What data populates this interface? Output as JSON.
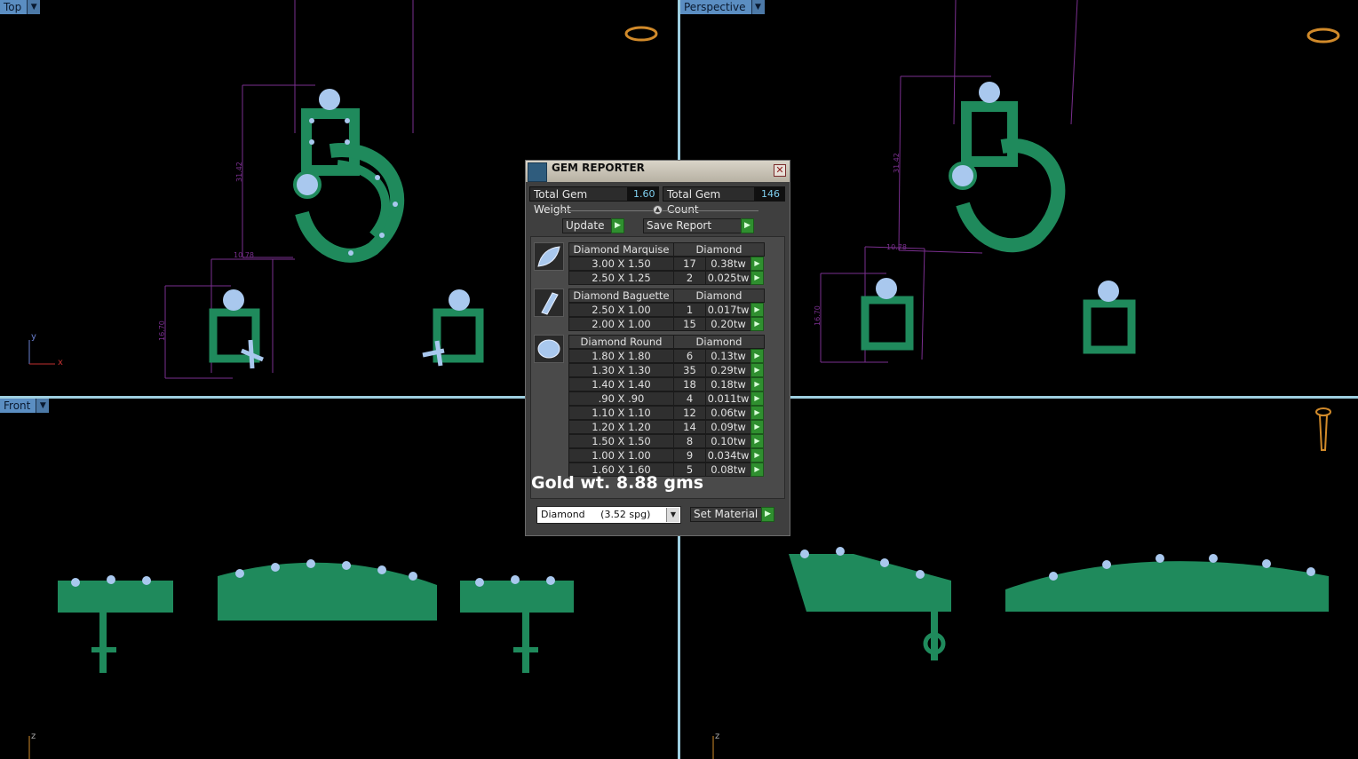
{
  "viewports": {
    "top": {
      "label": "Top"
    },
    "perspective": {
      "label": "Perspective"
    },
    "front": {
      "label": "Front"
    },
    "right": {
      "label": ""
    }
  },
  "axes": {
    "y": "y",
    "x": "x",
    "z": "z"
  },
  "dimensions": {
    "top_height": "31.42",
    "top_width": "10.78",
    "top_small": "16.70",
    "persp_height": "31.42",
    "persp_width": "10.78",
    "persp_small": "16.70"
  },
  "dialog": {
    "title": "GEM REPORTER",
    "close_glyph": "✕",
    "total_weight_label": "Total Gem Weight",
    "total_weight_value": "1.60",
    "total_count_label": "Total Gem Count",
    "total_count_value": "146",
    "update_label": "Update",
    "save_label": "Save Report",
    "go_glyph": "▶",
    "groups": [
      {
        "shape": "Diamond Marquise",
        "material": "Diamond",
        "rows": [
          {
            "size": "3.00 X 1.50",
            "count": "17",
            "weight": "0.38tw"
          },
          {
            "size": "2.50 X 1.25",
            "count": "2",
            "weight": "0.025tw"
          }
        ]
      },
      {
        "shape": "Diamond Baguette",
        "material": "Diamond",
        "rows": [
          {
            "size": "2.50 X 1.00",
            "count": "1",
            "weight": "0.017tw"
          },
          {
            "size": "2.00 X 1.00",
            "count": "15",
            "weight": "0.20tw"
          }
        ]
      },
      {
        "shape": "Diamond Round",
        "material": "Diamond",
        "rows": [
          {
            "size": "1.80 X 1.80",
            "count": "6",
            "weight": "0.13tw"
          },
          {
            "size": "1.30 X 1.30",
            "count": "35",
            "weight": "0.29tw"
          },
          {
            "size": "1.40 X 1.40",
            "count": "18",
            "weight": "0.18tw"
          },
          {
            "size": ".90 X .90",
            "count": "4",
            "weight": "0.011tw"
          },
          {
            "size": "1.10 X 1.10",
            "count": "12",
            "weight": "0.06tw"
          },
          {
            "size": "1.20 X 1.20",
            "count": "14",
            "weight": "0.09tw"
          },
          {
            "size": "1.50 X 1.50",
            "count": "8",
            "weight": "0.10tw"
          },
          {
            "size": "1.00 X 1.00",
            "count": "9",
            "weight": "0.034tw"
          },
          {
            "size": "1.60 X 1.60",
            "count": "5",
            "weight": "0.08tw"
          }
        ]
      }
    ],
    "gold_weight": "Gold wt. 8.88 gms",
    "material_select": "Diamond     (3.52 spg)",
    "set_material_label": "Set Material"
  },
  "colors": {
    "metal": "#1f8a5c",
    "gem": "#a9c8ee",
    "dim": "#7a2f8f",
    "label_bg": "#5b8ec2",
    "go": "#2f8f2f"
  }
}
